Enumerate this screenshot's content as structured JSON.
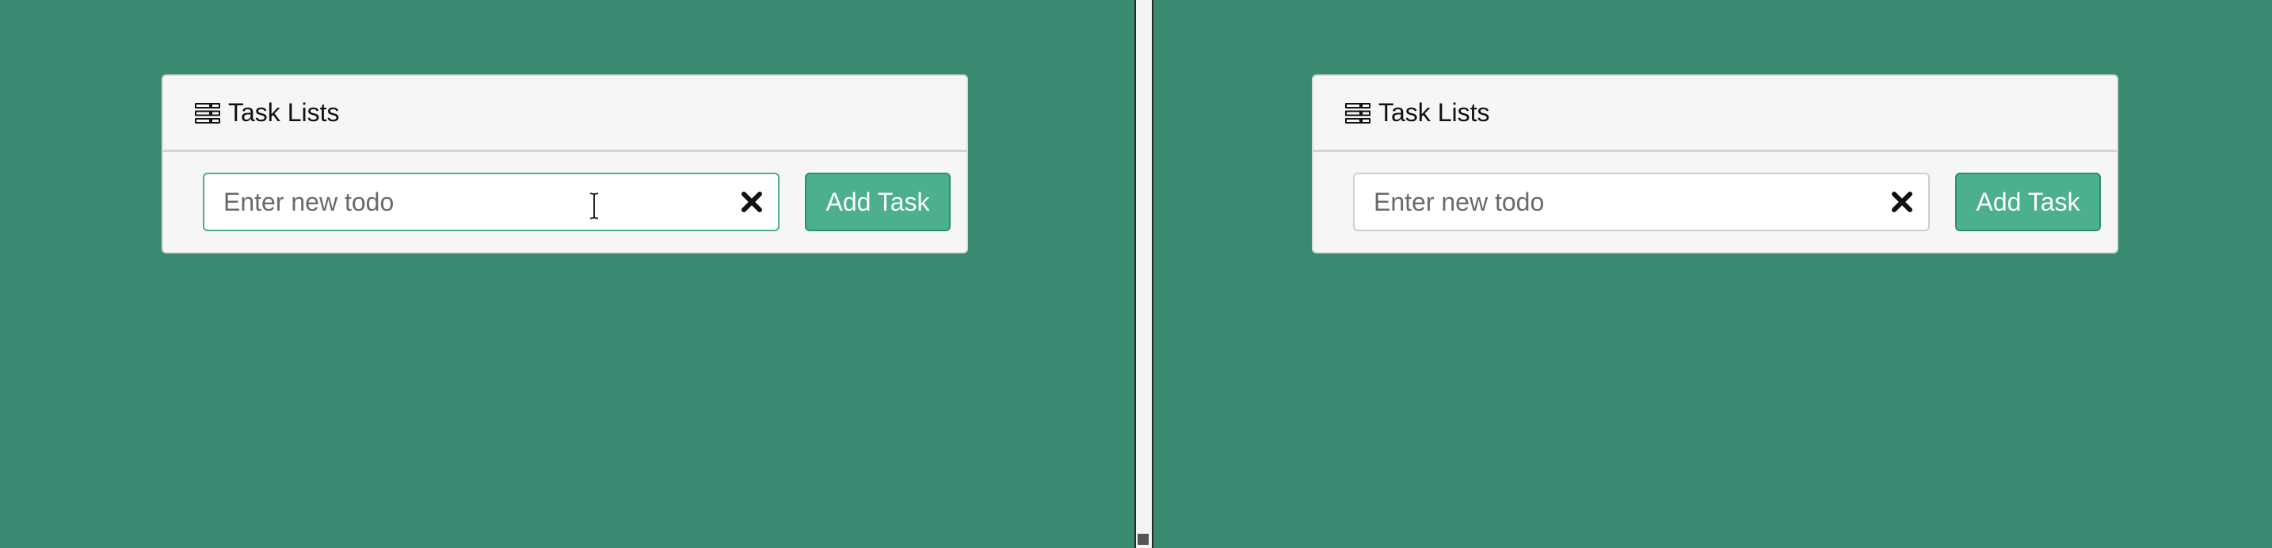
{
  "panes": {
    "left": {
      "card": {
        "icon": "list-icon",
        "title": "Task Lists"
      },
      "todo_input": {
        "value": "",
        "placeholder": "Enter new todo",
        "focused": true,
        "clear_icon": "close-icon"
      },
      "add_button_label": "Add Task"
    },
    "right": {
      "card": {
        "icon": "list-icon",
        "title": "Task Lists"
      },
      "todo_input": {
        "value": "",
        "placeholder": "Enter new todo",
        "focused": false,
        "clear_icon": "close-icon"
      },
      "add_button_label": "Add Task"
    }
  },
  "colors": {
    "background": "#3a8a72",
    "card_background": "#f6f6f6",
    "accent_button": "#4caf8d",
    "focus_border": "#4fae8c"
  }
}
